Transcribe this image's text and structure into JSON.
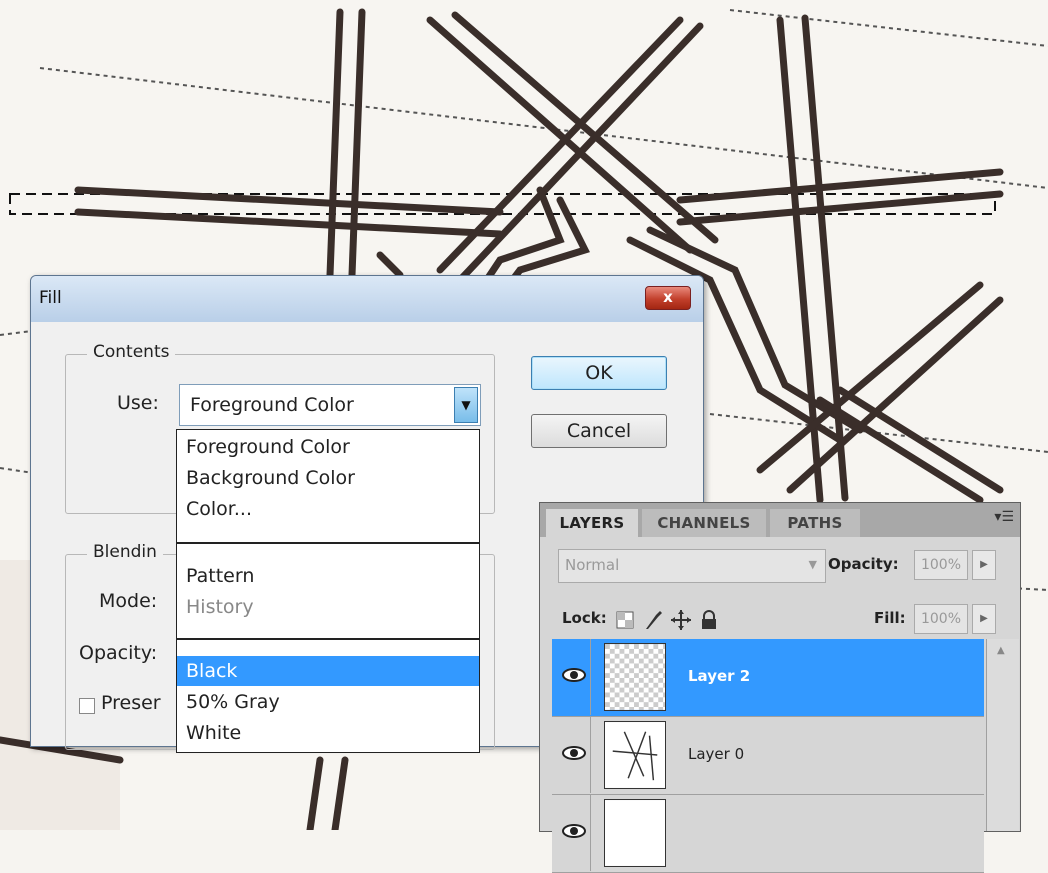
{
  "fill_dialog": {
    "title": "Fill",
    "close_label": "x",
    "contents_legend": "Contents",
    "use_label": "Use:",
    "use_value": "Foreground Color",
    "blending_legend": "Blendin",
    "mode_label": "Mode:",
    "opacity_label": "Opacity:",
    "preserve_label": "Preser",
    "ok_label": "OK",
    "cancel_label": "Cancel"
  },
  "use_dropdown": {
    "items": [
      {
        "label": "Foreground Color",
        "state": "normal"
      },
      {
        "label": "Background Color",
        "state": "normal"
      },
      {
        "label": "Color...",
        "state": "normal"
      },
      {
        "label": "Pattern",
        "state": "normal"
      },
      {
        "label": "History",
        "state": "disabled"
      },
      {
        "label": "Black",
        "state": "selected"
      },
      {
        "label": "50% Gray",
        "state": "normal"
      },
      {
        "label": "White",
        "state": "normal"
      }
    ]
  },
  "layers_panel": {
    "tabs": [
      "LAYERS",
      "CHANNELS",
      "PATHS"
    ],
    "active_tab": "LAYERS",
    "blend_mode": "Normal",
    "opacity_label": "Opacity:",
    "opacity_value": "100%",
    "lock_label": "Lock:",
    "fill_label": "Fill:",
    "fill_value": "100%",
    "layers": [
      {
        "name": "Layer 2",
        "selected": true,
        "visible": true
      },
      {
        "name": "Layer 0",
        "selected": false,
        "visible": true
      },
      {
        "name": "",
        "selected": false,
        "visible": true
      }
    ]
  },
  "colors": {
    "selection_blue": "#3399ff",
    "dialog_title_gradient_top": "#dbe8f6",
    "close_button_red": "#c2402c",
    "sketch_ink": "#3a2e2a"
  },
  "icons": {
    "close": "close-icon",
    "dropdown_arrow": "chevron-down-icon",
    "panel_menu": "panel-menu-icon",
    "lock_transparent": "lock-transparent-pixels-icon",
    "lock_image": "lock-image-pixels-icon",
    "lock_position": "lock-position-icon",
    "lock_all": "lock-all-icon",
    "visibility": "eye-icon"
  }
}
